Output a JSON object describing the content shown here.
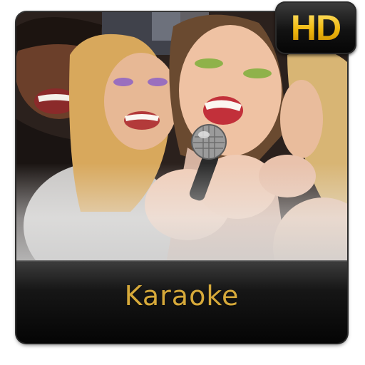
{
  "app": {
    "title": "Karaoke",
    "badge": "HD"
  },
  "colors": {
    "title_gold": "#d6a93a",
    "badge_gold": "#f2c21c",
    "frame_dark": "#0b0b0b"
  },
  "icons": {
    "photo": "karaoke-singers-photo",
    "microphone": "microphone-icon"
  }
}
